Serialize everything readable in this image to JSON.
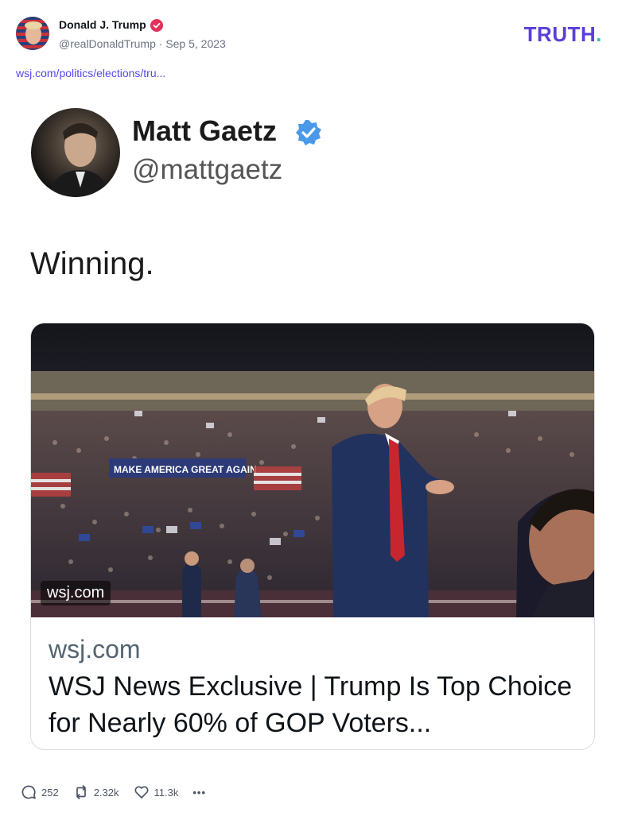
{
  "post": {
    "author_name": "Donald J. Trump",
    "handle": "@realDonaldTrump",
    "separator": "·",
    "date": "Sep 5, 2023",
    "brand": "TRUTH",
    "brand_dot": ".",
    "link_text": "wsj.com/politics/elections/tru..."
  },
  "embedded_tweet": {
    "name": "Matt Gaetz",
    "handle": "@mattgaetz",
    "text": "Winning.",
    "card": {
      "image_overlay": "wsj.com",
      "banner_text": "MAKE AMERICA GREAT AGAIN",
      "domain": "wsj.com",
      "title": "WSJ News Exclusive | Trump Is Top Choice for Nearly 60% of GOP Voters..."
    }
  },
  "actions": {
    "replies": "252",
    "reposts": "2.32k",
    "likes": "11.3k",
    "more": "•••"
  },
  "colors": {
    "brand": "#5b3fd9",
    "link": "#5448ee",
    "verified_red": "#e2315a",
    "verified_blue": "#4a99e9"
  },
  "icons": {
    "verified": "verified-badge-icon",
    "reply": "reply-icon",
    "repost": "repost-icon",
    "like": "heart-icon",
    "more": "more-icon"
  }
}
